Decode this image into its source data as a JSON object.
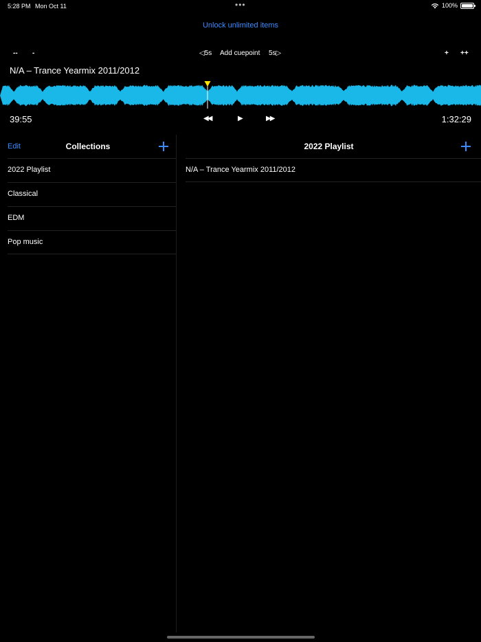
{
  "status_bar": {
    "time": "5:28 PM",
    "date": "Mon Oct 11",
    "battery": "100%",
    "dots": "•••"
  },
  "unlock_label": "Unlock unlimited items",
  "cue_toolbar": {
    "zoom_out_more": "--",
    "zoom_out": "-",
    "back_5s": "◁5s",
    "add_cuepoint": "Add cuepoint",
    "fwd_5s": "5s▷",
    "zoom_in": "+",
    "zoom_in_more": "++"
  },
  "player": {
    "track_title": "N/A – Trance Yearmix 2011/2012",
    "elapsed": "39:55",
    "total": "1:32:29",
    "rewind_icon": "◀◀",
    "play_icon": "▶",
    "forward_icon": "▶▶",
    "waveform_color": "#1ab8e8",
    "playhead_color": "#ffe600"
  },
  "collections": {
    "edit_label": "Edit",
    "title": "Collections",
    "items": [
      {
        "label": "2022 Playlist"
      },
      {
        "label": "Classical"
      },
      {
        "label": "EDM"
      },
      {
        "label": "Pop music"
      }
    ]
  },
  "playlist": {
    "title": "2022 Playlist",
    "tracks": [
      {
        "label": "N/A – Trance Yearmix 2011/2012"
      }
    ]
  },
  "accent_color": "#3a8bff"
}
